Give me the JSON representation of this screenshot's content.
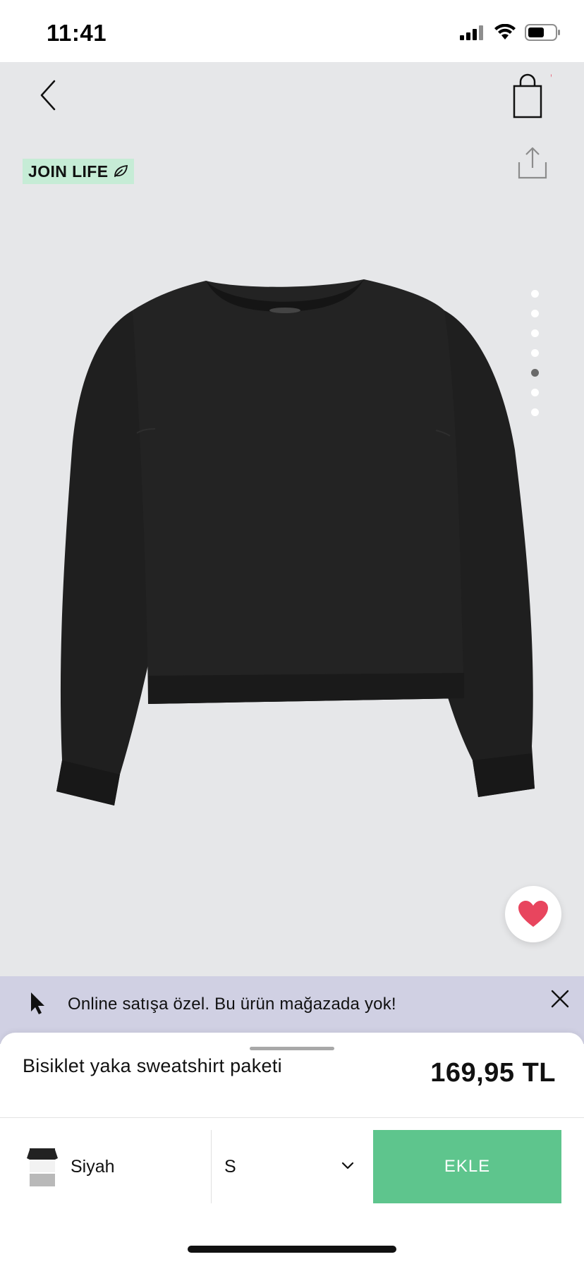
{
  "status_bar": {
    "time": "11:41"
  },
  "badge": {
    "label": "JOIN LIFE"
  },
  "gallery": {
    "image_count": 7,
    "active_index": 4
  },
  "notice": {
    "text": "Online satışa özel. Bu ürün mağazada yok!"
  },
  "product": {
    "title": "Bisiklet yaka sweatshirt paketi",
    "price": "169,95 TL"
  },
  "selectors": {
    "color_label": "Siyah",
    "size_value": "S"
  },
  "actions": {
    "add_label": "EKLE"
  },
  "icons": [
    "back-arrow-icon",
    "shopping-bag-icon",
    "share-icon",
    "leaf-icon",
    "heart-icon",
    "cursor-icon",
    "close-icon",
    "chevron-down-icon"
  ],
  "colors": {
    "accent_green": "#5ec58d",
    "favorite_red": "#e8455e",
    "notice_bg": "#d0d0e3",
    "badge_bg": "#c6ecd6"
  }
}
